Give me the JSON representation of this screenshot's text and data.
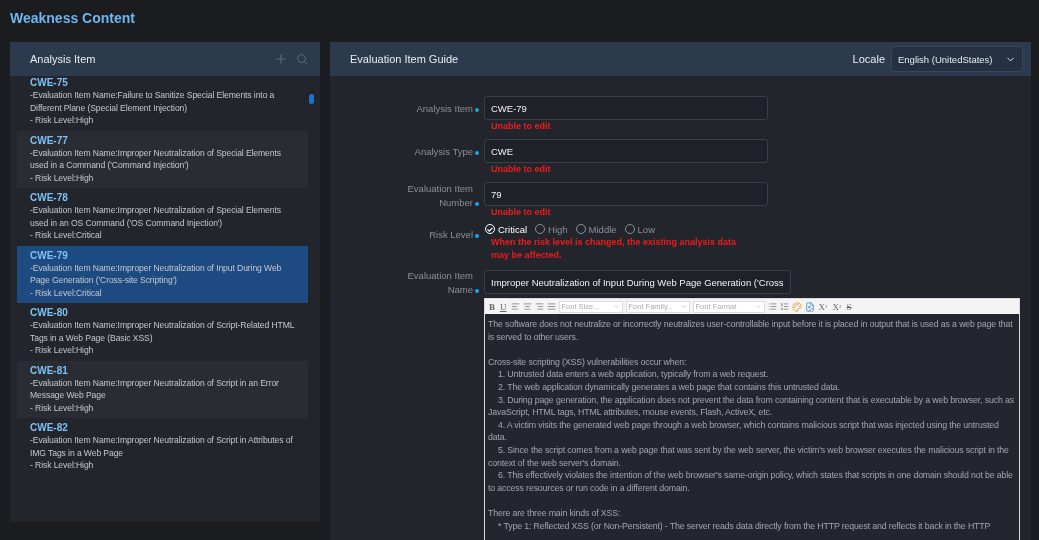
{
  "page_title": "Weakness Content",
  "analysis_panel": {
    "title": "Analysis Item",
    "items": [
      {
        "id": "CWE-75",
        "name_line": "-Evaluation Item Name:Failure to Sanitize Special Elements into a Different Plane (Special Element Injection)",
        "risk_line": "- Risk Level:High",
        "selected": false
      },
      {
        "id": "CWE-77",
        "name_line": "-Evaluation Item Name:Improper Neutralization of Special Elements used in a Command ('Command Injection')",
        "risk_line": "- Risk Level:High",
        "selected": false
      },
      {
        "id": "CWE-78",
        "name_line": "-Evaluation Item Name:Improper Neutralization of Special Elements used in an OS Command ('OS Command Injection')",
        "risk_line": "- Risk Level:Critical",
        "selected": false
      },
      {
        "id": "CWE-79",
        "name_line": "-Evaluation Item Name:Improper Neutralization of Input During Web Page Generation ('Cross-site Scripting')",
        "risk_line": "- Risk Level:Critical",
        "selected": true
      },
      {
        "id": "CWE-80",
        "name_line": "-Evaluation Item Name:Improper Neutralization of Script-Related HTML Tags in a Web Page (Basic XSS)",
        "risk_line": "- Risk Level:High",
        "selected": false
      },
      {
        "id": "CWE-81",
        "name_line": "-Evaluation Item Name:Improper Neutralization of Script in an Error Message Web Page",
        "risk_line": "- Risk Level:High",
        "selected": false
      },
      {
        "id": "CWE-82",
        "name_line": "-Evaluation Item Name:Improper Neutralization of Script in Attributes of IMG Tags in a Web Page",
        "risk_line": "- Risk Level:High",
        "selected": false
      }
    ]
  },
  "guide_panel": {
    "title": "Evaluation Item Guide",
    "locale_label": "Locale",
    "locale_value": "English (UnitedStates)",
    "fields": [
      {
        "label": "Analysis Item",
        "value": "CWE-79",
        "note": "Unable to edit"
      },
      {
        "label": "Analysis Type",
        "value": "CWE",
        "note": "Unable to edit"
      },
      {
        "label": "Evaluation Item Number",
        "value": "79",
        "note": "Unable to edit"
      }
    ],
    "risk_level": {
      "label": "Risk Level",
      "options": [
        {
          "label": "Critical",
          "selected": true
        },
        {
          "label": "High",
          "selected": false
        },
        {
          "label": "Middle",
          "selected": false
        },
        {
          "label": "Low",
          "selected": false
        }
      ],
      "warning": "When the risk level is changed, the existing analysis data may be affected."
    },
    "name_field": {
      "label": "Evaluation Item Name",
      "value": "Improper Neutralization of Input During Web Page Generation ('Cross"
    },
    "editor": {
      "toolbar": {
        "bold": "B",
        "underline": "U",
        "selects": [
          "Font Size...",
          "Font Family..",
          "Font Format"
        ],
        "subscript": "X",
        "subscript_mark": "2",
        "superscript": "X",
        "superscript_mark": "2",
        "strike": "S"
      },
      "paragraphs": [
        {
          "text": "The software does not neutralize or incorrectly neutralizes user-controllable input before it is placed in output that is used as a web page that is served to other users.",
          "indent": false,
          "gap_before": false
        },
        {
          "text": "Cross-site scripting (XSS) vulnerabilities occur when:",
          "indent": false,
          "gap_before": true
        },
        {
          "text": "1. Untrusted data enters a web application, typically from a web request.",
          "indent": true,
          "gap_before": false
        },
        {
          "text": "2. The web application dynamically generates a web page that contains this untrusted data.",
          "indent": true,
          "gap_before": false
        },
        {
          "text": "3. During page generation, the application does not prevent the data from containing content that is executable by a web browser, such as JavaScript, HTML tags, HTML attributes, mouse events, Flash, ActiveX, etc.",
          "indent": true,
          "gap_before": false
        },
        {
          "text": "4. A victim visits the generated web page through a web browser, which contains malicious script that was injected using the untrusted data.",
          "indent": true,
          "gap_before": false
        },
        {
          "text": "5. Since the script comes from a web page that was sent by the web server, the victim's web browser executes the malicious script in the context of the web server's domain.",
          "indent": true,
          "gap_before": false
        },
        {
          "text": "6. This effectively violates the intention of the web browser's same-origin policy, which states that scripts in one domain should not be able to access resources or run code in a different domain.",
          "indent": true,
          "gap_before": false
        },
        {
          "text": "There are three main kinds of XSS:",
          "indent": false,
          "gap_before": true
        },
        {
          "text": "* Type 1: Reflected XSS (or Non-Persistent) - The server reads data directly from the HTTP request and reflects it back in the HTTP",
          "indent": true,
          "gap_before": false
        }
      ]
    }
  }
}
